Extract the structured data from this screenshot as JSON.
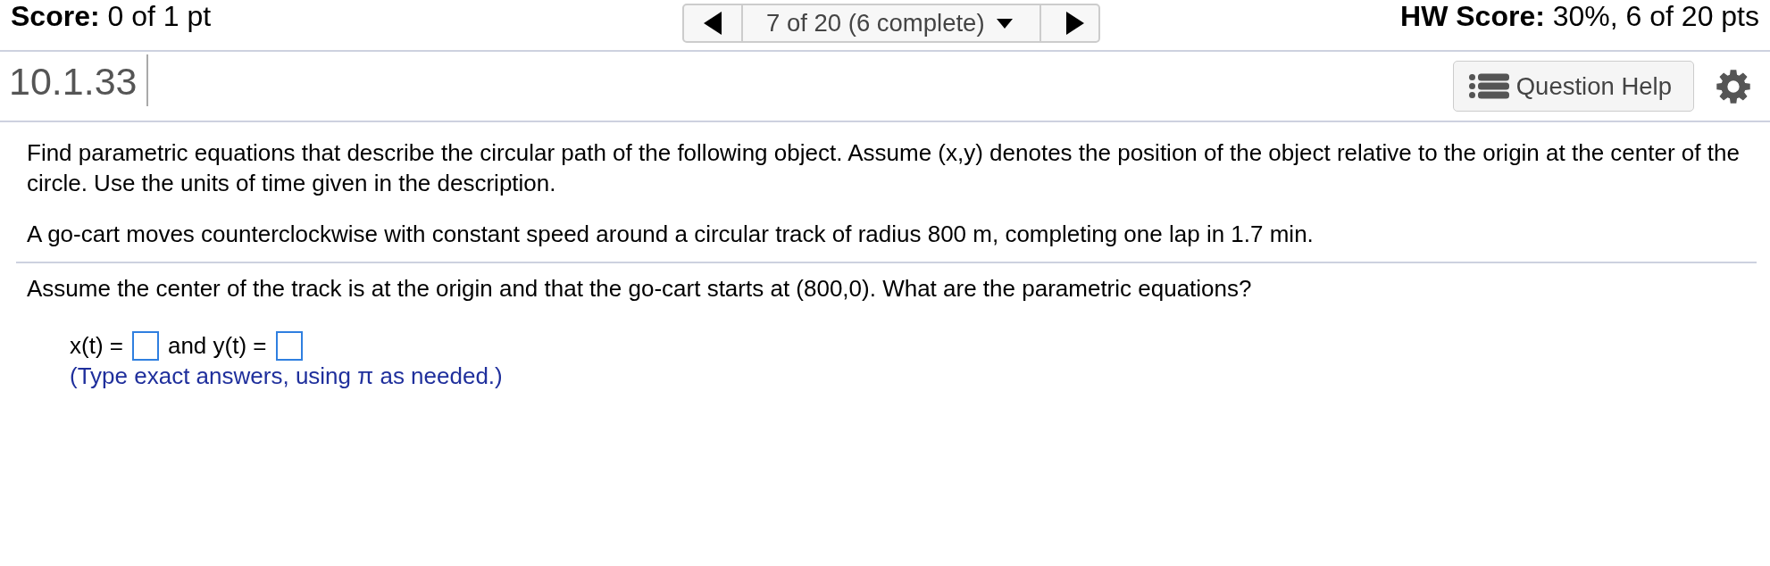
{
  "top_bar": {
    "score": "**Score:** 0 of 1 pt",
    "question_nav": {
      "position": "7 of 20 (6 complete)"
    },
    "hw_score": "**HW Score:** 30%, 6 of 20 pts"
  },
  "question_header": {
    "number": "10.1.33",
    "help_button": "Question Help"
  },
  "question": {
    "instructions": "Find parametric equations that describe the circular path of the following object. Assume (x,y) denotes the position of the object relative to the origin at the center of the circle. Use the units of time given in the description.",
    "problem": "A go-cart moves counterclockwise with constant speed around a circular track of radius 800 m, completing one lap in 1.7 min.",
    "prompt": "Assume the center of the track is at the origin and that the go-cart starts at (800,0). What are the parametric equations?",
    "answer_row": [
      {
        "kind": "text",
        "text": "x(t) ="
      },
      {
        "kind": "blank"
      },
      {
        "kind": "text",
        "text": "and y(t) ="
      },
      {
        "kind": "blank"
      }
    ],
    "hint": "(Type exact answers, using π as needed.)"
  }
}
